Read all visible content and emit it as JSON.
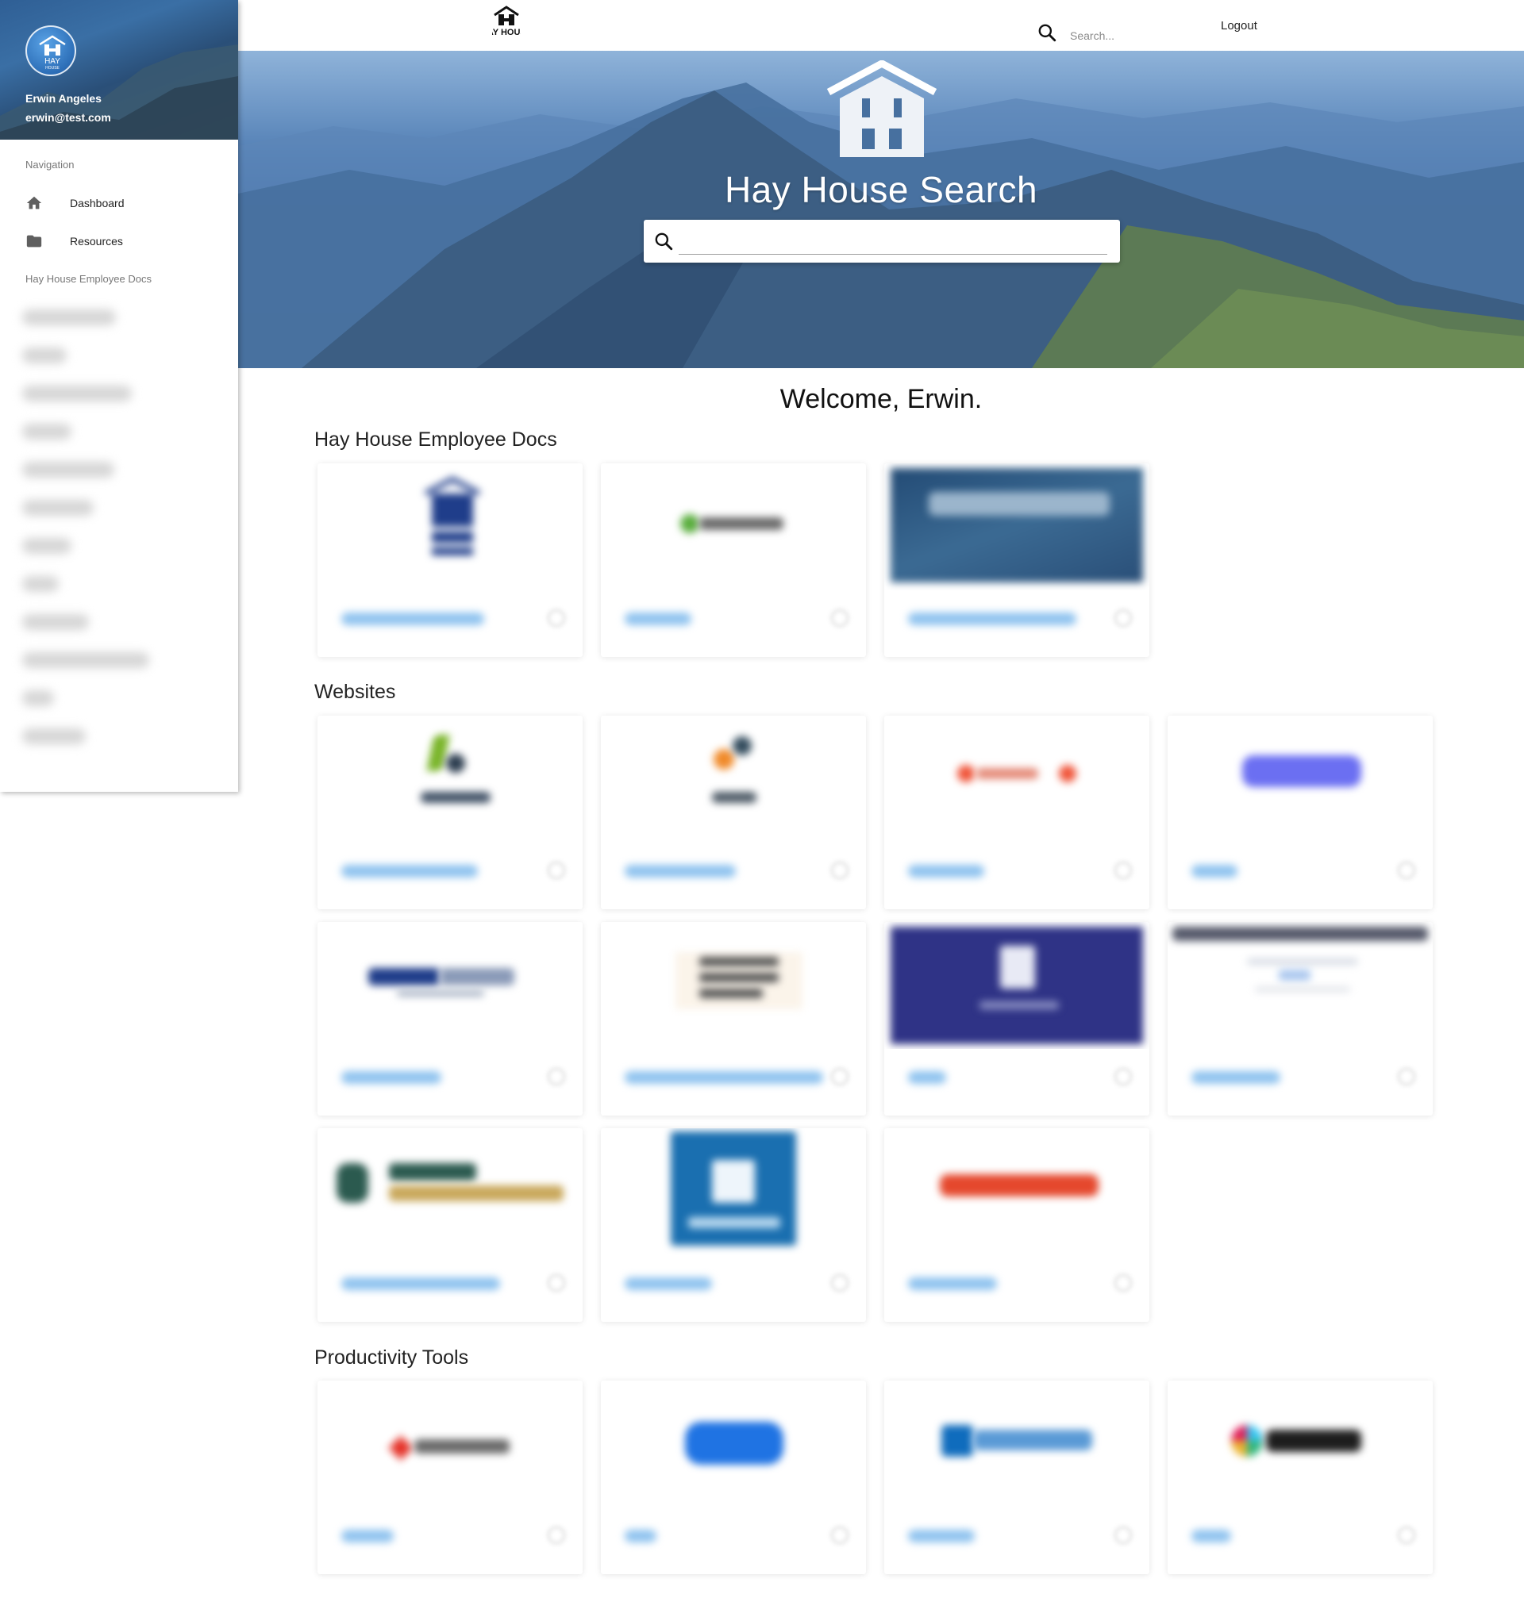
{
  "sidebar": {
    "user": {
      "name": "Erwin Angeles",
      "email": "erwin@test.com"
    },
    "navigation_header": "Navigation",
    "items": [
      {
        "label": "Dashboard",
        "icon": "home-icon"
      },
      {
        "label": "Resources",
        "icon": "folder-icon"
      }
    ],
    "docs_header": "Hay House Employee Docs"
  },
  "topbar": {
    "logo_text": "HAY HOUSE",
    "search_placeholder": "Search...",
    "logout_label": "Logout"
  },
  "hero": {
    "title": "Hay House Search",
    "search_icon": "search-icon"
  },
  "welcome": "Welcome, Erwin.",
  "sections": [
    {
      "title": "Hay House Employee Docs"
    },
    {
      "title": "Websites"
    },
    {
      "title": "Productivity Tools"
    }
  ],
  "colors": {
    "link_blue": "#8fc3ef",
    "hero_blue": "#4f7cb2",
    "sidebar_shadow": "#cccccc"
  }
}
